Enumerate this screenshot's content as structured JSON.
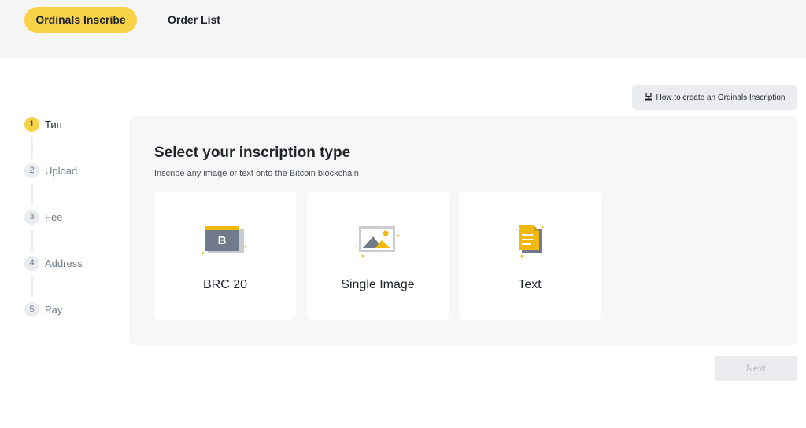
{
  "tabs": [
    {
      "label": "Ordinals Inscribe",
      "active": true
    },
    {
      "label": "Order List",
      "active": false
    }
  ],
  "help_button": {
    "label": "How to create an Ordinals Inscription",
    "icon": "sign-icon"
  },
  "steps": [
    {
      "number": "1",
      "label": "Тип",
      "active": true
    },
    {
      "number": "2",
      "label": "Upload",
      "active": false
    },
    {
      "number": "3",
      "label": "Fee",
      "active": false
    },
    {
      "number": "4",
      "label": "Address",
      "active": false
    },
    {
      "number": "5",
      "label": "Pay",
      "active": false
    }
  ],
  "panel": {
    "title": "Select your inscription type",
    "subtitle": "Inscribe any image or text onto the Bitcoin blockchain",
    "cards": [
      {
        "label": "BRC 20",
        "icon": "brc20-icon",
        "icon_letter": "B"
      },
      {
        "label": "Single Image",
        "icon": "image-icon"
      },
      {
        "label": "Text",
        "icon": "document-icon"
      }
    ]
  },
  "next_button": {
    "label": "Next",
    "enabled": false
  },
  "colors": {
    "accent": "#f7d146",
    "panel_bg": "#f7f7f7",
    "text": "#1e2329",
    "muted": "#707a8a"
  }
}
